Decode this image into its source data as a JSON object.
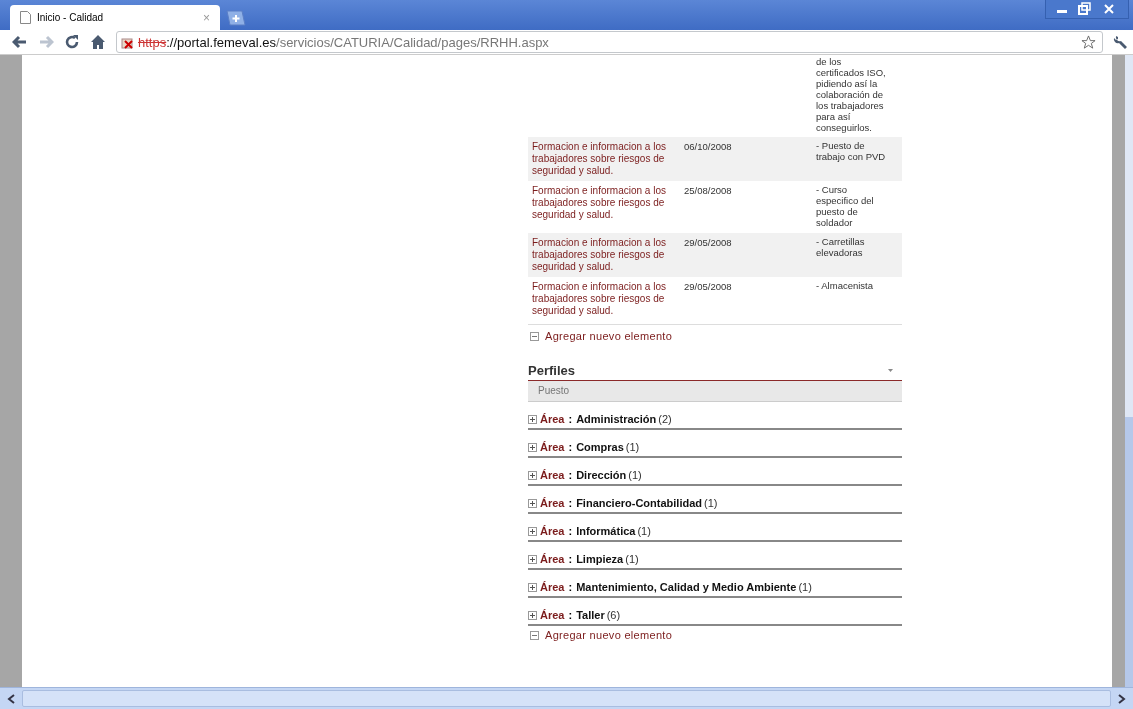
{
  "browser": {
    "tab": {
      "title": "Inicio - Calidad",
      "close": "×",
      "selected": true
    },
    "url": {
      "scheme": "https",
      "host": "://portal.femeval.es",
      "path": "/servicios/CATURIA/Calidad/pages/RRHH.aspx"
    }
  },
  "training_table": {
    "rows": [
      {
        "title": "",
        "date": "",
        "description": "de los certificados ISO, pidiendo así la colaboración de los trabajadores para así conseguirlos."
      },
      {
        "title": "Formacion e informacion a los trabajadores sobre riesgos de seguridad y salud.",
        "date": "06/10/2008",
        "description": "- Puesto de trabajo con PVD"
      },
      {
        "title": "Formacion e informacion a los trabajadores sobre riesgos de seguridad y salud.",
        "date": "25/08/2008",
        "description": "- Curso especifico del puesto de soldador"
      },
      {
        "title": "Formacion e informacion a los trabajadores sobre riesgos de seguridad y salud.",
        "date": "29/05/2008",
        "description": "- Carretillas elevadoras"
      },
      {
        "title": "Formacion e informacion a los trabajadores sobre riesgos de seguridad y salud.",
        "date": "29/05/2008",
        "description": "- Almacenista"
      }
    ],
    "add_link": "Agregar nuevo elemento"
  },
  "profiles": {
    "title": "Perfiles",
    "columns": [
      "Puesto"
    ],
    "groups": [
      {
        "field": "Área",
        "separator": ":",
        "value": "Administración",
        "count": "(2)",
        "expanded": false
      },
      {
        "field": "Área",
        "separator": ":",
        "value": "Compras",
        "count": "(1)",
        "expanded": false
      },
      {
        "field": "Área",
        "separator": ":",
        "value": "Dirección",
        "count": "(1)",
        "expanded": false
      },
      {
        "field": "Área",
        "separator": ":",
        "value": "Financiero-Contabilidad",
        "count": "(1)",
        "expanded": false
      },
      {
        "field": "Área",
        "separator": ":",
        "value": "Informática",
        "count": "(1)",
        "expanded": false
      },
      {
        "field": "Área",
        "separator": ":",
        "value": "Limpieza",
        "count": "(1)",
        "expanded": false
      },
      {
        "field": "Área",
        "separator": ":",
        "value": "Mantenimiento, Calidad y Medio Ambiente",
        "count": "(1)",
        "expanded": false
      },
      {
        "field": "Área",
        "separator": ":",
        "value": "Taller",
        "count": "(6)",
        "expanded": false
      }
    ],
    "add_link": "Agregar nuevo elemento"
  }
}
